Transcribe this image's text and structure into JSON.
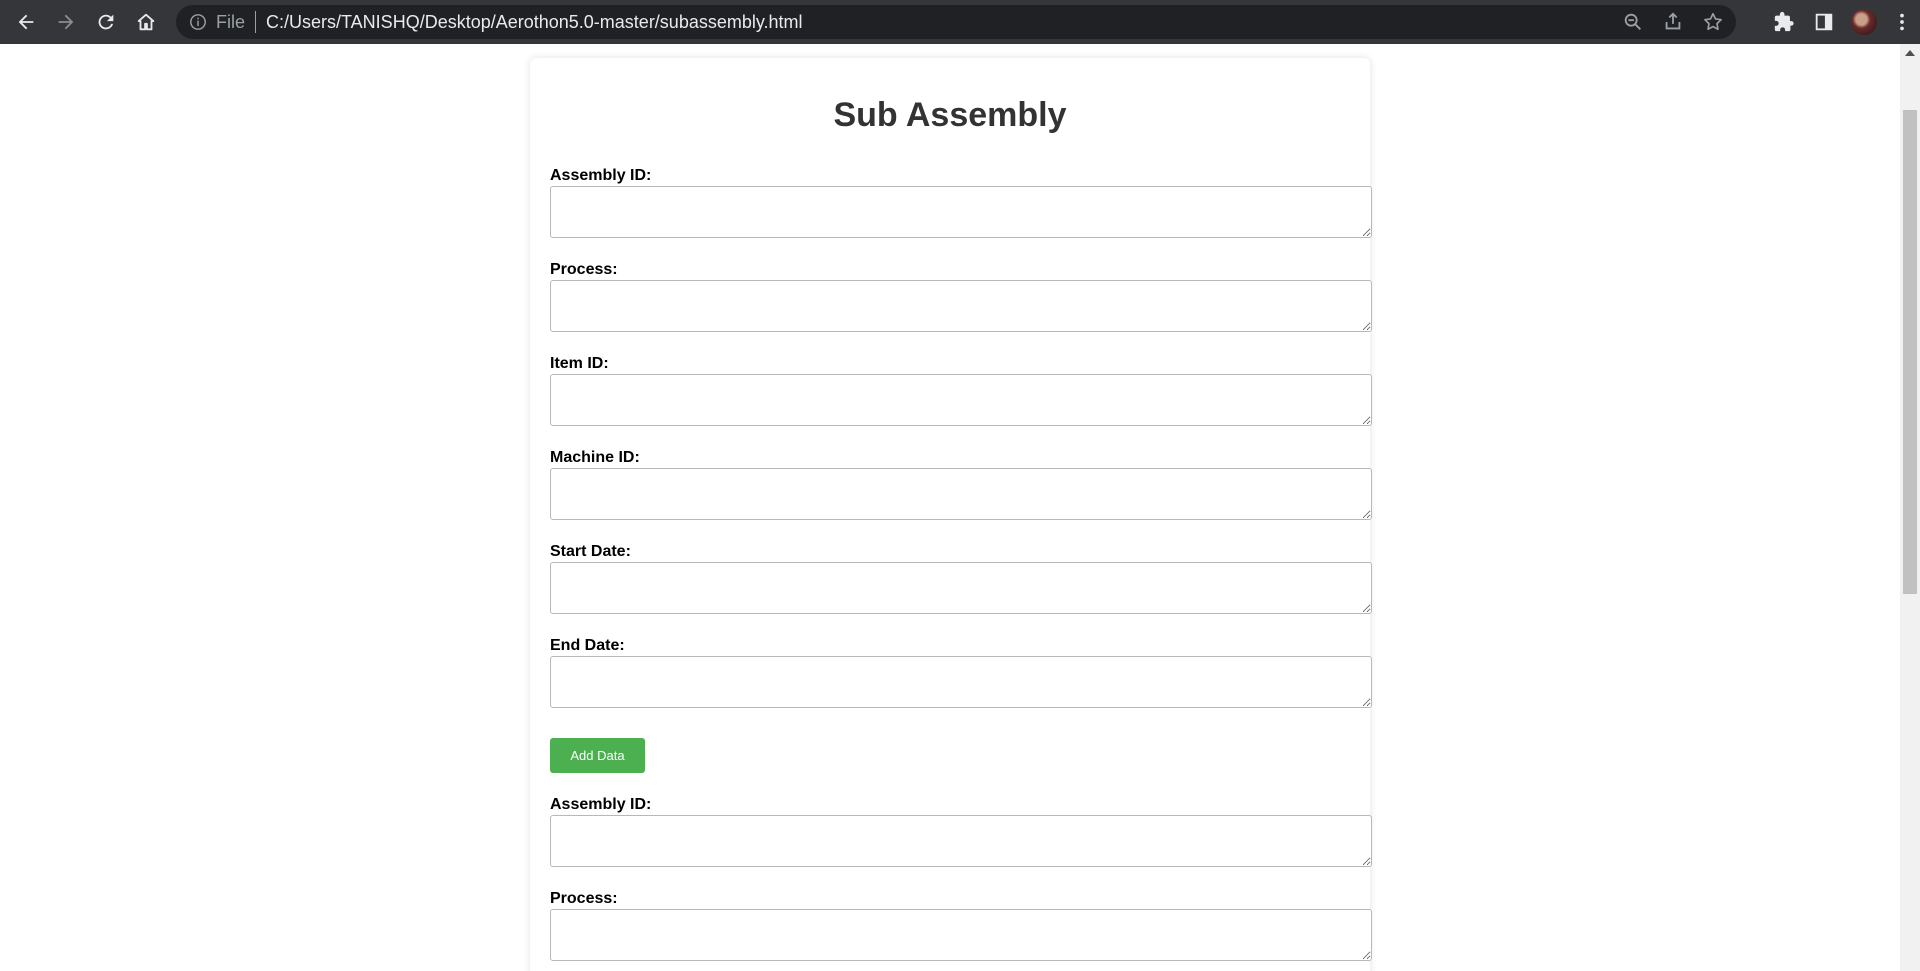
{
  "browser": {
    "file_label": "File",
    "url": "C:/Users/TANISHQ/Desktop/Aerothon5.0-master/subassembly.html"
  },
  "page": {
    "title": "Sub Assembly",
    "fields": [
      {
        "label": "Assembly ID:",
        "value": ""
      },
      {
        "label": "Process:",
        "value": ""
      },
      {
        "label": "Item ID:",
        "value": ""
      },
      {
        "label": "Machine ID:",
        "value": ""
      },
      {
        "label": "Start Date:",
        "value": ""
      },
      {
        "label": "End Date:",
        "value": ""
      }
    ],
    "add_button": "Add Data",
    "fields_second": [
      {
        "label": "Assembly ID:",
        "value": ""
      },
      {
        "label": "Process:",
        "value": ""
      }
    ]
  },
  "colors": {
    "toolbar_bg": "#35363a",
    "button_green": "#4caf50"
  }
}
